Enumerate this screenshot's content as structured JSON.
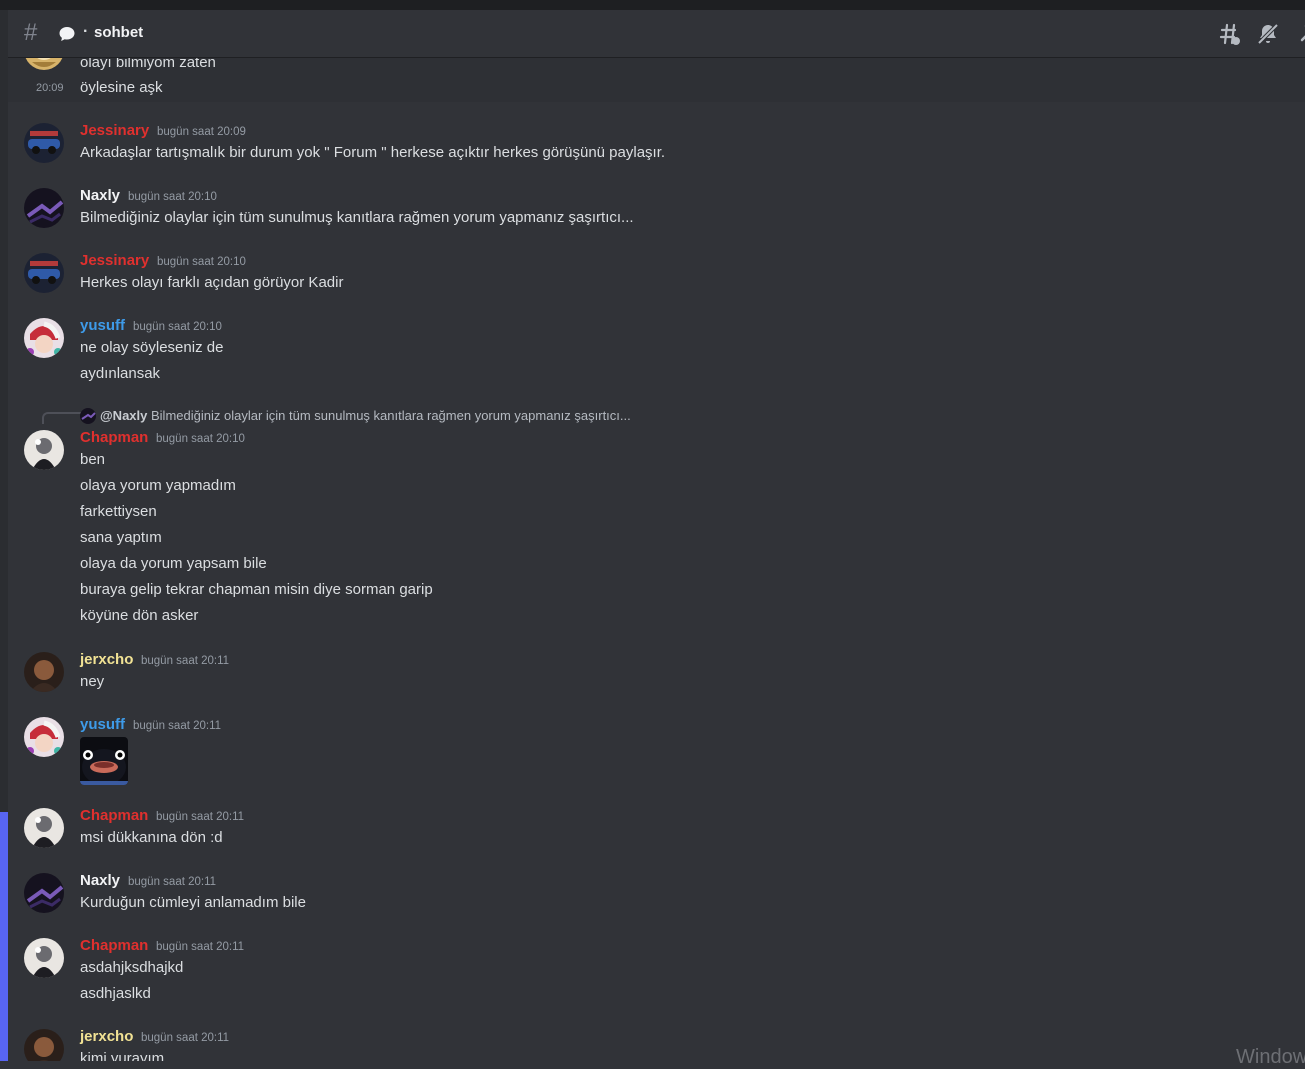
{
  "header": {
    "channel_name": "sohbet",
    "channel_prefix": "·"
  },
  "colors": {
    "background": "#313338",
    "chapman": "#e0302e",
    "jessinary": "#e0302e",
    "naxly": "#f2f3f5",
    "yusuff": "#3e9be9",
    "jerxcho": "#f1e294",
    "accent": "#5865f2"
  },
  "top_partial": {
    "line1": "olayı bilmiyom zaten",
    "time": "20:09",
    "line2": "öylesine aşk"
  },
  "messages": [
    {
      "author": "Jessinary",
      "time": "bugün saat 20:09",
      "lines": [
        "Arkadaşlar tartışmalık bir durum yok \" Forum \" herkese açıktır herkes görüşünü paylaşır."
      ]
    },
    {
      "author": "Naxly",
      "time": "bugün saat 20:10",
      "lines": [
        "Bilmediğiniz olaylar için tüm sunulmuş kanıtlara rağmen yorum yapmanız şaşırtıcı..."
      ]
    },
    {
      "author": "Jessinary",
      "time": "bugün saat 20:10",
      "lines": [
        "Herkes olayı farklı açıdan görüyor Kadir"
      ]
    },
    {
      "author": "yusuff",
      "time": "bugün saat 20:10",
      "lines": [
        "ne olay söyleseniz de",
        "aydınlansak"
      ]
    },
    {
      "author": "Chapman",
      "time": "bugün saat 20:10",
      "reply": {
        "name": "@Naxly",
        "text": "Bilmediğiniz olaylar için tüm sunulmuş kanıtlara rağmen yorum yapmanız şaşırtıcı..."
      },
      "lines": [
        "ben",
        "olaya yorum yapmadım",
        "farkettiysen",
        "sana yaptım",
        "olaya da yorum yapsam bile",
        "buraya gelip tekrar chapman misin diye sorman garip",
        "köyüne dön asker"
      ]
    },
    {
      "author": "jerxcho",
      "time": "bugün saat 20:11",
      "lines": [
        "ney"
      ]
    },
    {
      "author": "yusuff",
      "time": "bugün saat 20:11",
      "sticker": "penguin-sticker"
    },
    {
      "author": "Chapman",
      "time": "bugün saat 20:11",
      "lines": [
        "msi dükkanına dön :d"
      ]
    },
    {
      "author": "Naxly",
      "time": "bugün saat 20:11",
      "lines": [
        "Kurduğun cümleyi anlamadım bile"
      ]
    },
    {
      "author": "Chapman",
      "time": "bugün saat 20:11",
      "lines": [
        "asdahjksdhajkd",
        "asdhjaslkd"
      ]
    },
    {
      "author": "jerxcho",
      "time": "bugün saat 20:11",
      "lines": [
        "kimi yurayım"
      ]
    }
  ],
  "watermark": "Window"
}
